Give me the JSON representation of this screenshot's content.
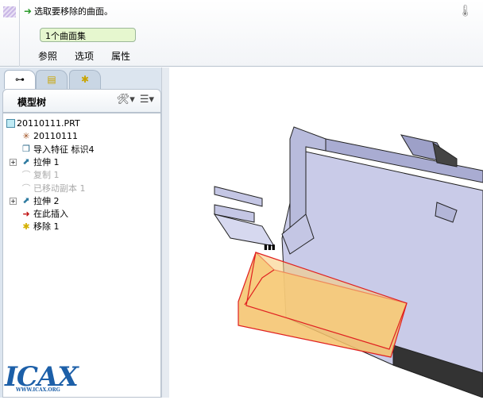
{
  "dashboard": {
    "prompt": "选取要移除的曲面。",
    "collector": "1个曲面集",
    "tabs": [
      "参照",
      "选项",
      "属性"
    ]
  },
  "left": {
    "tabs": [
      "model-tree",
      "layers",
      "favorites"
    ],
    "tree_title": "模型树",
    "tree": [
      {
        "label": "20110111.PRT",
        "icon": "part-icon",
        "dim": false,
        "expand": false
      },
      {
        "label": "20110111",
        "icon": "csys-icon",
        "dim": false,
        "expand": false
      },
      {
        "label": "导入特征 标识4",
        "icon": "import-feature-icon",
        "dim": false,
        "expand": false
      },
      {
        "label": "拉伸 1",
        "icon": "extrude-icon",
        "dim": false,
        "expand": true
      },
      {
        "label": "复制 1",
        "icon": "copy-icon",
        "dim": true,
        "expand": false
      },
      {
        "label": "已移动副本 1",
        "icon": "moved-copy-icon",
        "dim": true,
        "expand": false
      },
      {
        "label": "拉伸 2",
        "icon": "extrude-icon",
        "dim": false,
        "expand": true
      },
      {
        "label": "在此插入",
        "icon": "insert-here-arrow-icon",
        "dim": false,
        "expand": false
      },
      {
        "label": "移除 1",
        "icon": "remove-icon",
        "dim": false,
        "expand": false
      }
    ]
  },
  "logo": {
    "text": "ICAX",
    "url": "WWW.ICAX.ORG"
  },
  "colors": {
    "selection": "#f5c26a",
    "edge": "#e02020",
    "body": "#c9cbe8"
  }
}
